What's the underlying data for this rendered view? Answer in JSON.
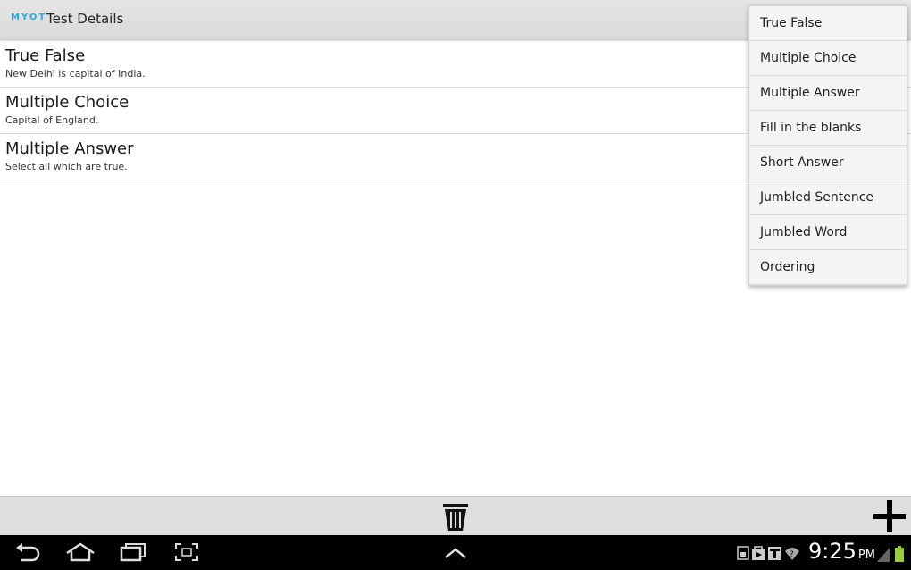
{
  "app": {
    "logo": "MYOT",
    "title": "Test Details"
  },
  "questions": [
    {
      "title": "True False",
      "subtitle": "New Delhi is capital of India."
    },
    {
      "title": "Multiple Choice",
      "subtitle": "Capital of England."
    },
    {
      "title": "Multiple Answer",
      "subtitle": "Select all which are true."
    }
  ],
  "menu": {
    "items": [
      "True False",
      "Multiple Choice",
      "Multiple Answer",
      "Fill in the blanks",
      "Short Answer",
      "Jumbled Sentence",
      "Jumbled Word",
      "Ordering"
    ]
  },
  "toolbar": {
    "delete_icon": "trash-icon",
    "add_icon": "plus-icon"
  },
  "system": {
    "time": "9:25",
    "ampm": "PM",
    "nav_icons": [
      "back-icon",
      "home-icon",
      "recent-apps-icon",
      "screenshot-icon",
      "chevron-up-icon"
    ],
    "status_icons": [
      "sd-card-icon",
      "shopping-bag-icon",
      "play-store-icon",
      "t-icon",
      "wifi-icon",
      "signal-icon",
      "battery-icon"
    ],
    "battery_color": "#9ccc3c"
  }
}
